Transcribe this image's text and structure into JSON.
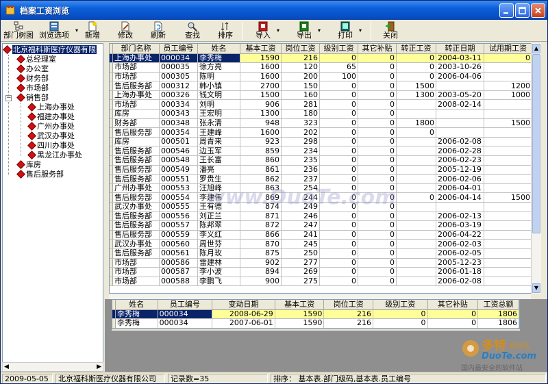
{
  "window": {
    "title": "档案工资浏览"
  },
  "toolbar": {
    "items": [
      {
        "label": "部门树图",
        "icon": "tree-icon"
      },
      {
        "label": "浏览选项",
        "icon": "options-icon",
        "dropdown": true
      },
      {
        "label": "新增",
        "icon": "new-icon"
      },
      {
        "label": "修改",
        "icon": "edit-icon"
      },
      {
        "label": "刷新",
        "icon": "refresh-icon"
      },
      {
        "label": "查找",
        "icon": "find-icon"
      },
      {
        "label": "排序",
        "icon": "sort-icon"
      },
      {
        "label": "导入",
        "icon": "import-icon",
        "dropdown": true
      },
      {
        "label": "导出",
        "icon": "export-icon",
        "dropdown": true
      },
      {
        "label": "打印",
        "icon": "print-icon",
        "dropdown": true
      },
      {
        "label": "关闭",
        "icon": "close-door-icon"
      }
    ]
  },
  "tree": {
    "root": "北京福科斯医疗仪器有限",
    "nodes": [
      "总经理室",
      "办公室",
      "财务部",
      "市场部",
      "销售部"
    ],
    "sales_children": [
      "上海办事处",
      "福建办事处",
      "广州办事处",
      "武汉办事处",
      "四川办事处",
      "黑龙江办事处"
    ],
    "more": [
      "库房",
      "售后服务部"
    ]
  },
  "grid": {
    "columns": [
      "部门名称",
      "员工编号",
      "姓名",
      "基本工资",
      "岗位工资",
      "级别工资",
      "其它补贴",
      "转正工资",
      "转正日期",
      "试用期工资"
    ],
    "rows": [
      [
        "上海办事处",
        "000034",
        "李秀梅",
        "1590",
        "216",
        "0",
        "0",
        "0",
        "2004-03-11",
        "0"
      ],
      [
        "市场部",
        "000035",
        "徐方亮",
        "1600",
        "120",
        "65",
        "0",
        "0",
        "2003-10-26",
        ""
      ],
      [
        "市场部",
        "000305",
        "陈明",
        "1600",
        "200",
        "100",
        "0",
        "0",
        "2006-04-06",
        ""
      ],
      [
        "售后服务部",
        "000312",
        "韩小镇",
        "2700",
        "150",
        "0",
        "0",
        "1500",
        "",
        "1200"
      ],
      [
        "上海办事处",
        "000326",
        "钱文明",
        "1500",
        "160",
        "0",
        "0",
        "1300",
        "2003-05-20",
        "1000"
      ],
      [
        "市场部",
        "000334",
        "刘明",
        "906",
        "281",
        "0",
        "0",
        "",
        "2008-02-14",
        ""
      ],
      [
        "库房",
        "000343",
        "王宏明",
        "1300",
        "180",
        "0",
        "0",
        "",
        "",
        ""
      ],
      [
        "财务部",
        "000348",
        "张永清",
        "948",
        "323",
        "0",
        "0",
        "1800",
        "",
        "1500"
      ],
      [
        "售后服务部",
        "000354",
        "王建峰",
        "1600",
        "202",
        "0",
        "0",
        "0",
        "",
        ""
      ],
      [
        "库房",
        "000501",
        "周青来",
        "923",
        "298",
        "0",
        "0",
        "",
        "2006-02-08",
        ""
      ],
      [
        "售后服务部",
        "000546",
        "边玉军",
        "859",
        "234",
        "0",
        "0",
        "",
        "2006-02-28",
        ""
      ],
      [
        "售后服务部",
        "000548",
        "王长富",
        "860",
        "235",
        "0",
        "0",
        "",
        "2006-02-23",
        ""
      ],
      [
        "售后服务部",
        "000549",
        "潘亮",
        "861",
        "236",
        "0",
        "0",
        "",
        "2005-12-19",
        ""
      ],
      [
        "售后服务部",
        "000551",
        "罗贵生",
        "862",
        "237",
        "0",
        "0",
        "",
        "2006-02-06",
        ""
      ],
      [
        "广州办事处",
        "000553",
        "汪旭峰",
        "863",
        "254",
        "0",
        "0",
        "",
        "2006-04-01",
        ""
      ],
      [
        "售后服务部",
        "000554",
        "李建伟",
        "869",
        "244",
        "0",
        "0",
        "0",
        "2006-04-14",
        "1500"
      ],
      [
        "武汉办事处",
        "000555",
        "王有德",
        "874",
        "249",
        "0",
        "0",
        "",
        "",
        ""
      ],
      [
        "售后服务部",
        "000556",
        "刘正兰",
        "871",
        "246",
        "0",
        "0",
        "",
        "2006-02-13",
        ""
      ],
      [
        "售后服务部",
        "000557",
        "陈邦翠",
        "872",
        "247",
        "0",
        "0",
        "",
        "2006-03-19",
        ""
      ],
      [
        "售后服务部",
        "000559",
        "李义红",
        "866",
        "241",
        "0",
        "0",
        "",
        "2006-04-22",
        ""
      ],
      [
        "武汉办事处",
        "000560",
        "周世芬",
        "870",
        "245",
        "0",
        "0",
        "",
        "2006-02-03",
        ""
      ],
      [
        "售后服务部",
        "000561",
        "陈月玫",
        "875",
        "250",
        "0",
        "0",
        "",
        "2006-02-05",
        ""
      ],
      [
        "市场部",
        "000586",
        "雷建林",
        "902",
        "277",
        "0",
        "0",
        "",
        "2005-12-23",
        ""
      ],
      [
        "市场部",
        "000587",
        "李小波",
        "894",
        "269",
        "0",
        "0",
        "",
        "2006-01-18",
        ""
      ],
      [
        "市场部",
        "000588",
        "李鹏飞",
        "900",
        "275",
        "0",
        "0",
        "",
        "2006-02-08",
        ""
      ]
    ]
  },
  "detail": {
    "columns": [
      "姓名",
      "员工编号",
      "变动日期",
      "基本工资",
      "岗位工资",
      "级别工资",
      "其它补贴",
      "工资总额"
    ],
    "rows": [
      [
        "李秀梅",
        "000034",
        "2008-06-29",
        "1590",
        "216",
        "0",
        "0",
        "1806"
      ],
      [
        "李秀梅",
        "000034",
        "2007-06-01",
        "1590",
        "216",
        "0",
        "0",
        "1806"
      ]
    ]
  },
  "status": {
    "date": "2009-05-05",
    "company": "北京福科斯医疗仪器有限公司",
    "count": "记录数=35",
    "sort": "排序：  基本表.部门级码,基本表.员工编号"
  },
  "watermark": {
    "center": "www.DuoTe.com",
    "logo_big": "多特",
    "logo_small": "软件站",
    "logo_url": "DuoTe.com",
    "logo_sub": "国内最安全的软件站"
  },
  "colors": {
    "selection": "#0a246a",
    "highlight_cell": "#ffff99",
    "title_bar": "#0a5fd8",
    "dept_icon": "#d01010"
  }
}
